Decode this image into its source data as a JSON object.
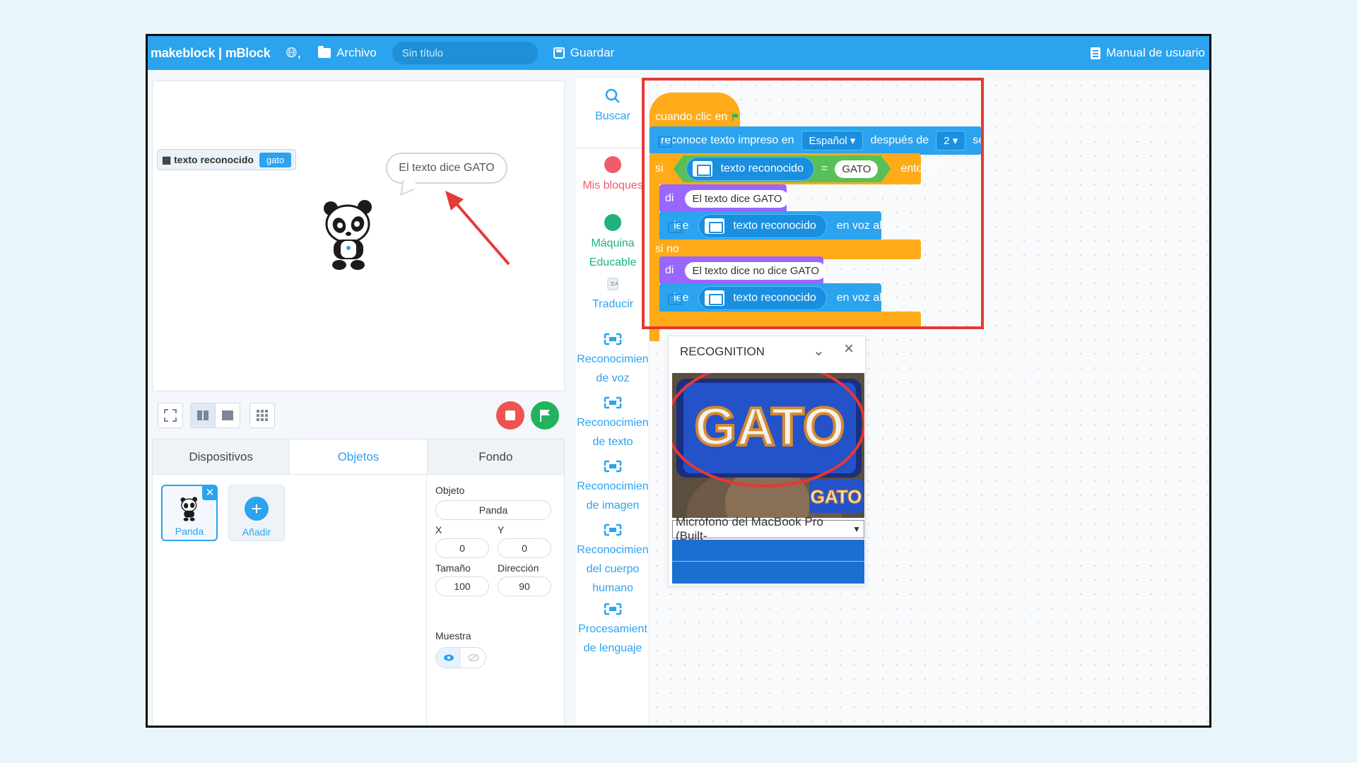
{
  "topbar": {
    "brand": "makeblock | mBlock",
    "archivo": "Archivo",
    "title_placeholder": "Sin título",
    "guardar": "Guardar",
    "manual": "Manual de usuario"
  },
  "stage": {
    "variable_label": "texto reconocido",
    "variable_value": "gato",
    "speech": "El texto dice GATO"
  },
  "tabs": [
    "Dispositivos",
    "Objetos",
    "Fondo"
  ],
  "sprites": {
    "panda_label": "Panda",
    "add_label": "Añadir"
  },
  "props": {
    "objeto_label": "Objeto",
    "objeto_value": "Panda",
    "x_label": "X",
    "x_value": "0",
    "y_label": "Y",
    "y_value": "0",
    "tamano_label": "Tamaño",
    "tamano_value": "100",
    "direccion_label": "Dirección",
    "direccion_value": "90",
    "muestra_label": "Muestra"
  },
  "categories": {
    "buscar": "Buscar",
    "mis_bloques": "Mis bloques",
    "maquina": "Máquina Educable",
    "traducir": "Traducir",
    "voz": "Reconocimien de voz",
    "texto": "Reconocimien de texto",
    "imagen": "Reconocimien de imagen",
    "cuerpo": "Reconocimien del cuerpo humano",
    "lenguaje": "Procesamient de lenguaje",
    "colors": {
      "mis_bloques": "#ef5c6b",
      "maquina": "#1db37a"
    }
  },
  "script": {
    "hat": "cuando clic en",
    "recog_prefix": "reconoce texto impreso en",
    "recog_lang": "Español ▾",
    "recog_mid": "después de",
    "recog_secs": "2 ▾",
    "recog_suffix": "seg",
    "if": "si",
    "cond_var": "texto reconocido",
    "cond_eq": "=",
    "cond_value": "GATO",
    "then": "entonces",
    "say1_kw": "di",
    "say1_text": "El texto dice GATO",
    "read1_kw": "lee",
    "read1_var": "texto reconocido",
    "read1_suffix": "en voz alta",
    "else": "si no",
    "say2_kw": "di",
    "say2_text": "El texto dice no dice GATO",
    "read2_kw": "lee",
    "read2_var": "texto reconocido",
    "read2_suffix": "en voz alta"
  },
  "recognition": {
    "title": "RECOGNITION",
    "camera_text": "GATO",
    "camera_text_small": "GATO",
    "microphone": "Micrófono del MacBook Pro (Built-"
  },
  "colors": {
    "accent": "#2ba3ee",
    "control": "#ffab19",
    "looks": "#9966ff",
    "highlight": "#e53935"
  }
}
